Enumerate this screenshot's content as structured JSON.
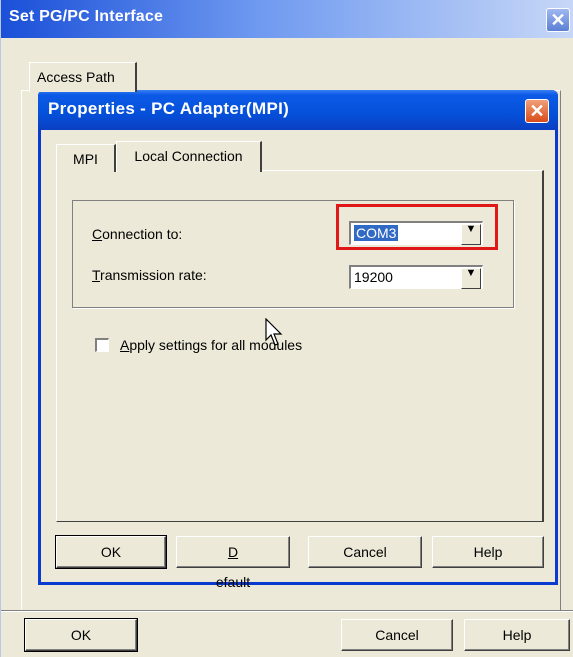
{
  "outer_window": {
    "title": "Set PG/PC Interface",
    "close_glyph": "✕",
    "tabs": [
      "Access Path"
    ],
    "buttons": {
      "ok": "OK",
      "cancel": "Cancel",
      "help": "Help"
    }
  },
  "dialog": {
    "title": "Properties - PC Adapter(MPI)",
    "close_glyph": "✕",
    "tabs": [
      {
        "label": "MPI",
        "active": false
      },
      {
        "label": "Local Connection",
        "active": true
      }
    ],
    "connection": {
      "label": "Connection to:",
      "value": "COM3"
    },
    "transmission": {
      "label": "Transmission rate:",
      "value": "19200"
    },
    "apply_all": {
      "label": "Apply settings for all modules",
      "checked": false
    },
    "buttons": {
      "ok": "OK",
      "default": "Default",
      "cancel": "Cancel",
      "help": "Help"
    }
  },
  "icons": {
    "dropdown": "chevron-down-icon",
    "cursor": "mouse-pointer-icon"
  },
  "colors": {
    "titlebar_blue": "#0550d9",
    "close_red": "#d94c1a",
    "highlight_border": "#e01818",
    "selection": "#316ac5",
    "face": "#ece9d8"
  }
}
